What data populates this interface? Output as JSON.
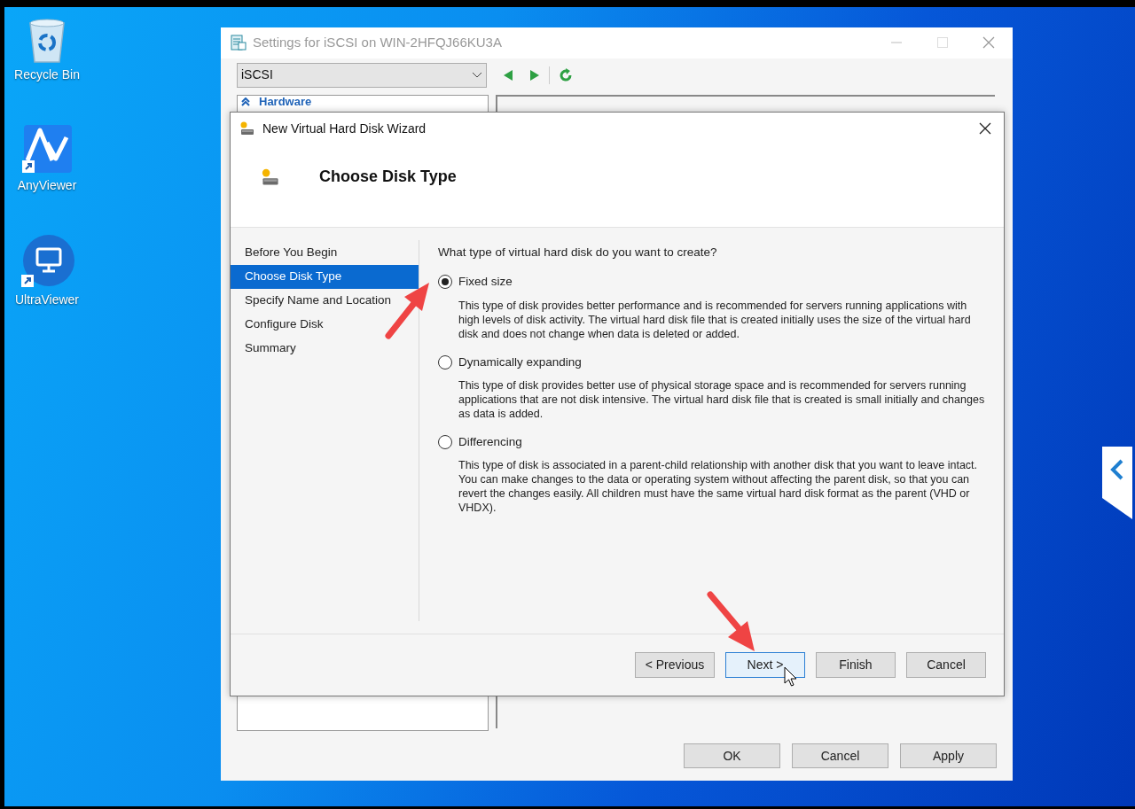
{
  "desktop_icons": [
    {
      "kind": "recycle",
      "label": "Recycle Bin"
    },
    {
      "kind": "anyviewer",
      "label": "AnyViewer"
    },
    {
      "kind": "ultraviewer",
      "label": "UltraViewer"
    }
  ],
  "settings_window": {
    "title": "Settings for iSCSI on WIN-2HFQJ66KU3A",
    "vm_select": "iSCSI",
    "tree_header": "Hardware",
    "buttons": [
      "OK",
      "Cancel",
      "Apply"
    ]
  },
  "wizard": {
    "title": "New Virtual Hard Disk Wizard",
    "page_title": "Choose Disk Type",
    "steps": [
      {
        "label": "Before You Begin",
        "selected": false
      },
      {
        "label": "Choose Disk Type",
        "selected": true
      },
      {
        "label": "Specify Name and Location",
        "selected": false
      },
      {
        "label": "Configure Disk",
        "selected": false
      },
      {
        "label": "Summary",
        "selected": false
      }
    ],
    "question": "What type of virtual hard disk do you want to create?",
    "options": [
      {
        "label": "Fixed size",
        "selected": true,
        "description": "This type of disk provides better performance and is recommended for servers running applications with high levels of disk activity. The virtual hard disk file that is created initially uses the size of the virtual hard disk and does not change when data is deleted or added."
      },
      {
        "label": "Dynamically expanding",
        "selected": false,
        "description": "This type of disk provides better use of physical storage space and is recommended for servers running applications that are not disk intensive. The virtual hard disk file that is created is small initially and changes as data is added."
      },
      {
        "label": "Differencing",
        "selected": false,
        "description": "This type of disk is associated in a parent-child relationship with another disk that you want to leave intact. You can make changes to the data or operating system without affecting the parent disk, so that you can revert the changes easily. All children must have the same virtual hard disk format as the parent (VHD or VHDX)."
      }
    ],
    "buttons": [
      {
        "label": "< Previous",
        "focused": false
      },
      {
        "label": "Next >",
        "focused": true
      },
      {
        "label": "Finish",
        "focused": false
      },
      {
        "label": "Cancel",
        "focused": false
      }
    ]
  }
}
